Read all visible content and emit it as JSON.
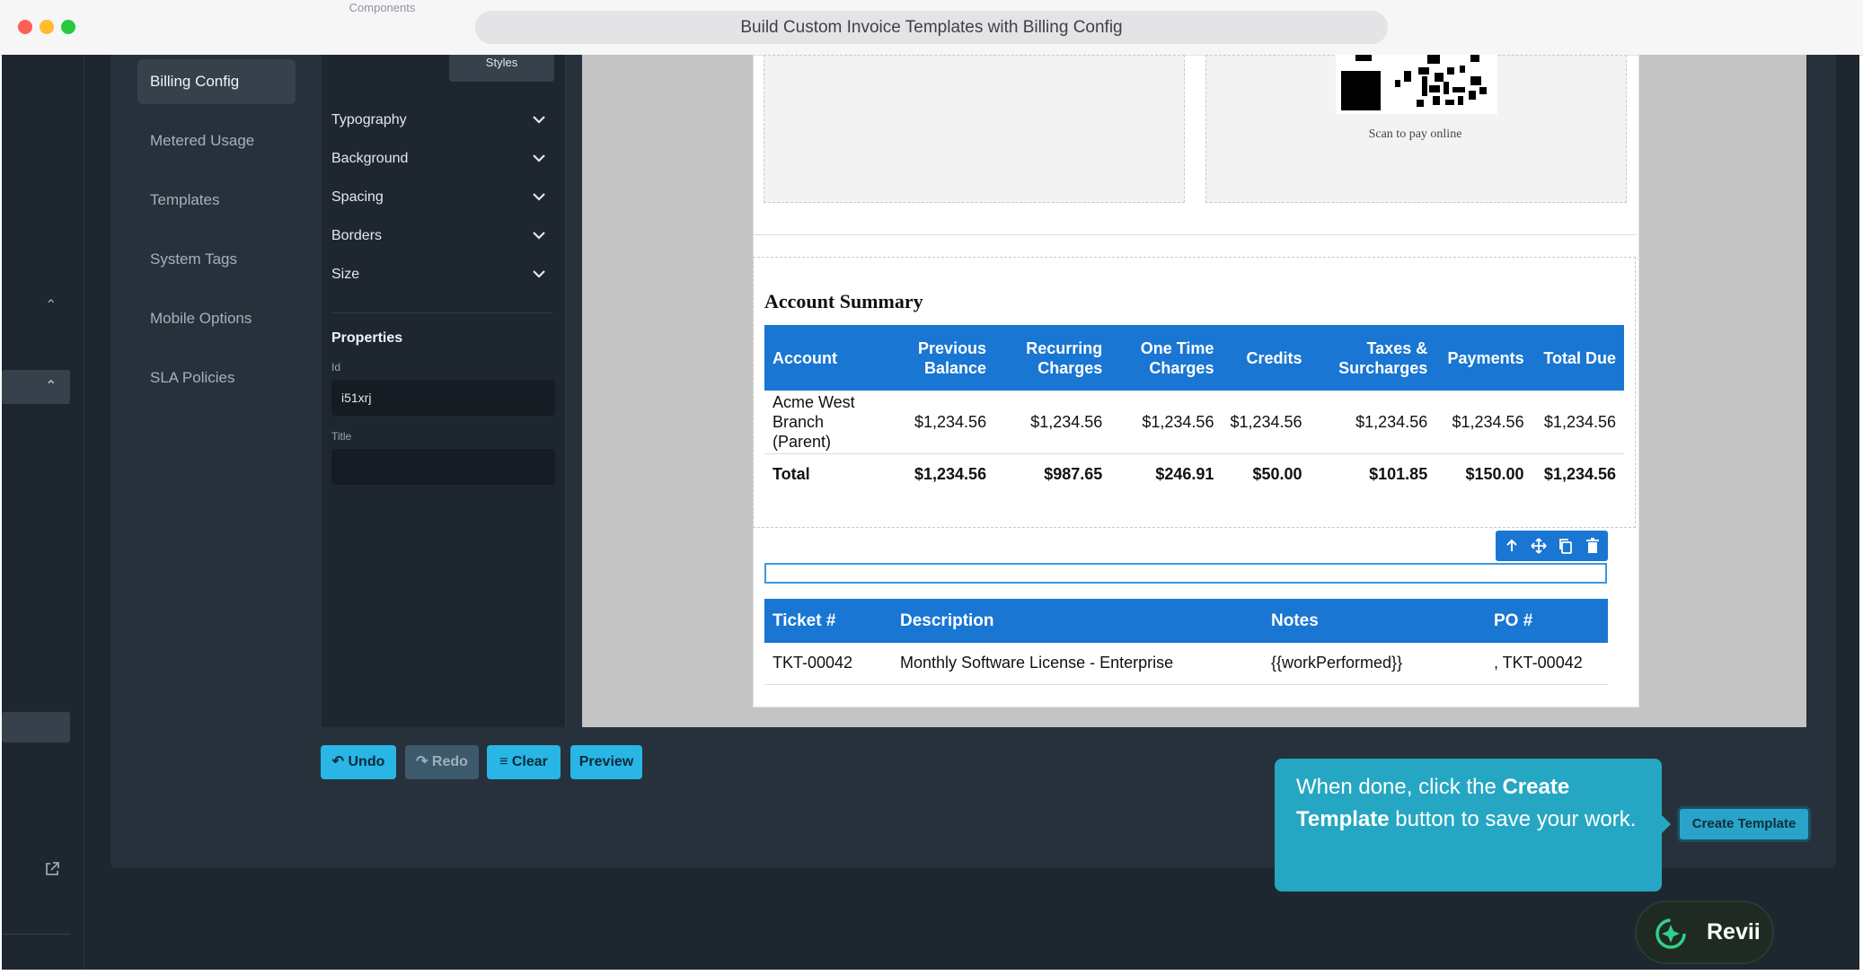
{
  "window": {
    "title": "Build Custom Invoice Templates with Billing Config"
  },
  "nav": {
    "items": [
      {
        "label": "Billing Config",
        "active": true
      },
      {
        "label": "Metered Usage"
      },
      {
        "label": "Templates"
      },
      {
        "label": "System Tags"
      },
      {
        "label": "Mobile Options"
      },
      {
        "label": "SLA Policies"
      }
    ]
  },
  "style_manager": {
    "tabs": [
      "Components",
      "Styles"
    ],
    "active_tab": "Styles",
    "sectors": [
      "Typography",
      "Background",
      "Spacing",
      "Borders",
      "Size"
    ],
    "properties_title": "Properties",
    "id_label": "Id",
    "id_value": "i51xrj",
    "title_label": "Title",
    "title_value": ""
  },
  "invoice": {
    "qr_caption": "Scan to pay online",
    "summary": {
      "title": "Account Summary",
      "headers": [
        "Account",
        "Previous Balance",
        "Recurring Charges",
        "One Time Charges",
        "Credits",
        "Taxes & Surcharges",
        "Payments",
        "Total Due"
      ],
      "rows": [
        [
          "Acme West Branch (Parent)",
          "$1,234.56",
          "$1,234.56",
          "$1,234.56",
          "$1,234.56",
          "$1,234.56",
          "$1,234.56",
          "$1,234.56"
        ]
      ],
      "total": [
        "Total",
        "$1,234.56",
        "$987.65",
        "$246.91",
        "$50.00",
        "$101.85",
        "$150.00",
        "$1,234.56"
      ]
    },
    "tickets": {
      "headers": [
        "Ticket #",
        "Description",
        "Notes",
        "PO #"
      ],
      "rows": [
        [
          "TKT-00042",
          "Monthly Software License - Enterprise",
          "{{workPerformed}}",
          ", TKT-00042"
        ]
      ]
    }
  },
  "toolbar": {
    "undo": "Undo",
    "redo": "Redo",
    "clear": "Clear",
    "preview": "Preview"
  },
  "tooltip": {
    "pre": "When done, click the ",
    "bold": "Create Template",
    "post": " button to save your work."
  },
  "create_button": "Create Template",
  "assistant": {
    "label": "Revii"
  },
  "colors": {
    "accent": "#29b6e6",
    "table_header": "#1976d2",
    "app_bg": "#1e2730"
  }
}
